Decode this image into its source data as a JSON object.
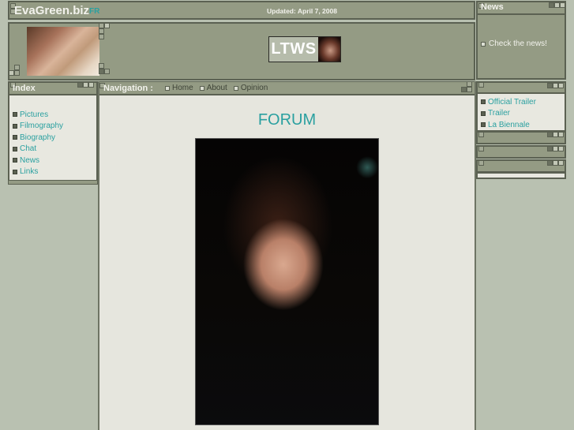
{
  "header": {
    "site_title": "EvaGreen.biz",
    "lang_link": "FR",
    "updated": "Updated: April 7, 2008"
  },
  "banner": {
    "photo_alt": "banner-photo",
    "ltws_label": "LTWS"
  },
  "news": {
    "title": "News",
    "item": "Check the news!"
  },
  "index": {
    "title": "Index",
    "items": [
      {
        "label": "Pictures"
      },
      {
        "label": "Filmography"
      },
      {
        "label": "Biography"
      },
      {
        "label": "Chat"
      },
      {
        "label": "News"
      },
      {
        "label": "Links"
      }
    ]
  },
  "nav": {
    "label": "Navigation :",
    "links": [
      {
        "label": "Home"
      },
      {
        "label": "About"
      },
      {
        "label": "Opinion"
      }
    ]
  },
  "main": {
    "heading": "FORUM"
  },
  "right_links": {
    "items": [
      {
        "label": "Official Trailer"
      },
      {
        "label": "Trailer"
      },
      {
        "label": "La Biennale"
      }
    ]
  },
  "colors": {
    "accent": "#2aa0a0",
    "panel": "#949b84",
    "page_bg": "#b9c1b1",
    "content_bg": "#e6e6de"
  }
}
